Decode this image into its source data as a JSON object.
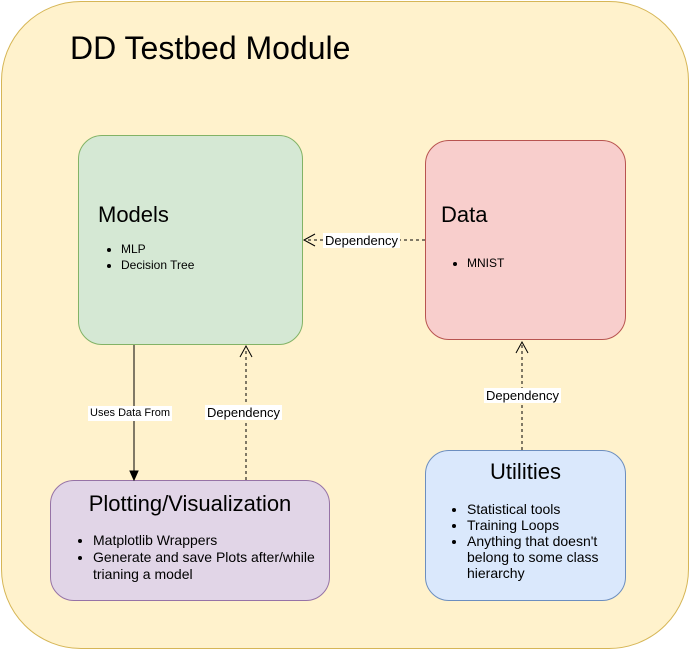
{
  "module": {
    "title": "DD Testbed Module"
  },
  "boxes": {
    "models": {
      "title": "Models",
      "items": [
        "MLP",
        "Decision Tree"
      ]
    },
    "data": {
      "title": "Data",
      "items": [
        "MNIST"
      ]
    },
    "plotting": {
      "title": "Plotting/Visualization",
      "items": [
        "Matplotlib Wrappers",
        "Generate and save Plots after/while trianing a model"
      ]
    },
    "utilities": {
      "title": "Utilities",
      "items": [
        "Statistical tools",
        "Training Loops",
        "Anything that doesn't belong to some class hierarchy"
      ]
    }
  },
  "edges": {
    "data_to_models": "Dependency",
    "models_to_plotting": "Uses Data From",
    "plotting_to_models": "Dependency",
    "utilities_to_data": "Dependency"
  }
}
